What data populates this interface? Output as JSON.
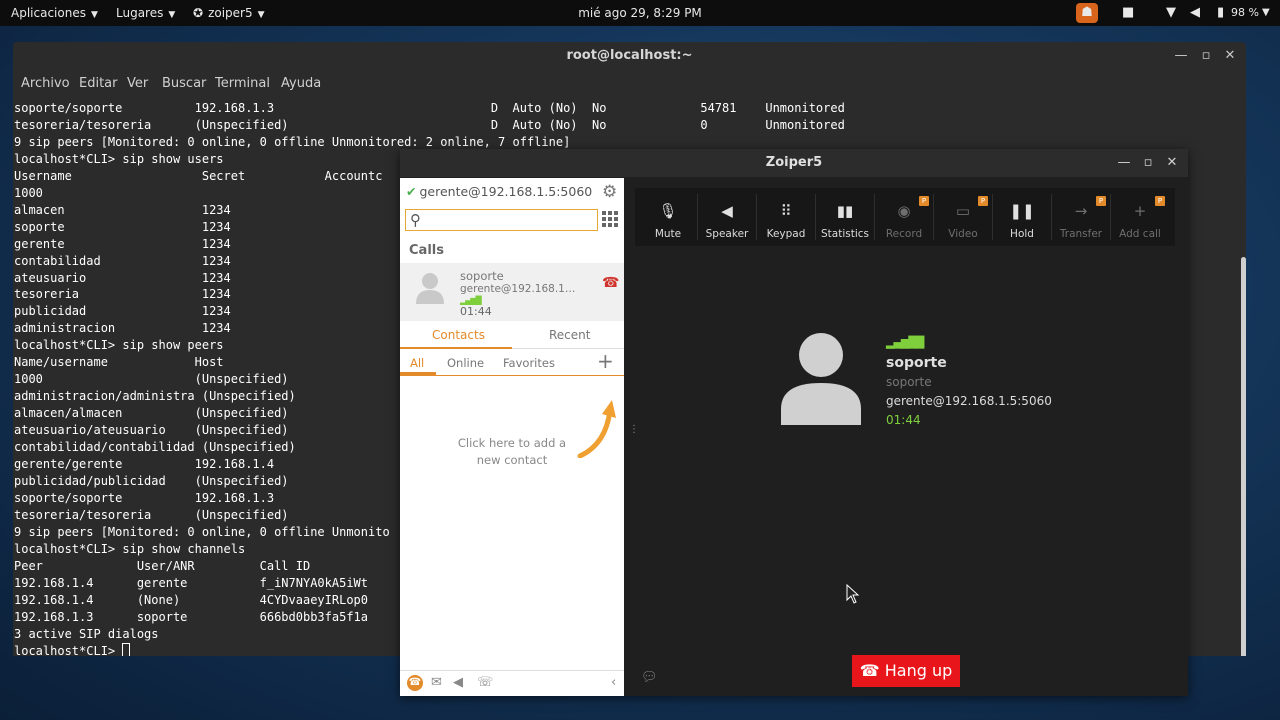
{
  "topbar": {
    "apps": "Aplicaciones",
    "places": "Lugares",
    "current_app": "zoiper5",
    "clock": "mié ago 29,  8:29 PM",
    "battery": "98 %"
  },
  "terminal": {
    "title": "root@localhost:~",
    "menu": [
      "Archivo",
      "Editar",
      "Ver",
      "Buscar",
      "Terminal",
      "Ayuda"
    ],
    "lines": [
      "soporte/soporte          192.168.1.3                              D  Auto (No)  No             54781    Unmonitored",
      "tesoreria/tesoreria      (Unspecified)                            D  Auto (No)  No             0        Unmonitored",
      "9 sip peers [Monitored: 0 online, 0 offline Unmonitored: 2 online, 7 offline]",
      "localhost*CLI> sip show users",
      "Username                  Secret           Accountc",
      "1000",
      "almacen                   1234",
      "soporte                   1234",
      "gerente                   1234",
      "contabilidad              1234",
      "ateusuario                1234",
      "tesoreria                 1234",
      "publicidad                1234",
      "administracion            1234",
      "localhost*CLI> sip show peers",
      "Name/username            Host",
      "1000                     (Unspecified)",
      "administracion/administra (Unspecified)",
      "almacen/almacen          (Unspecified)",
      "ateusuario/ateusuario    (Unspecified)",
      "contabilidad/contabilidad (Unspecified)",
      "gerente/gerente          192.168.1.4",
      "publicidad/publicidad    (Unspecified)",
      "soporte/soporte          192.168.1.3",
      "tesoreria/tesoreria      (Unspecified)",
      "9 sip peers [Monitored: 0 online, 0 offline Unmonito",
      "localhost*CLI> sip show channels",
      "Peer             User/ANR         Call ID",
      "192.168.1.4      gerente          f_iN7NYA0kA5iWt",
      "192.168.1.4      (None)           4CYDvaaeyIRLop0",
      "192.168.1.3      soporte          666bd0bb3fa5f1a",
      "3 active SIP dialogs"
    ],
    "prompt": "localhost*CLI> "
  },
  "zoiper": {
    "title": "Zoiper5",
    "account": "gerente@192.168.1.5:5060",
    "search_placeholder": "",
    "calls_label": "Calls",
    "call_item": {
      "name": "soporte",
      "account": "gerente@192.168.1.5:5060",
      "time": "01:44"
    },
    "tabs": [
      "Contacts",
      "Recent"
    ],
    "subtabs": [
      "All",
      "Online",
      "Favorites"
    ],
    "add_contact_hint_1": "Click here to add a",
    "add_contact_hint_2": "new contact",
    "toolbar": [
      {
        "label": "Mute",
        "icon": "mic-off-icon",
        "disabled": false,
        "badge": ""
      },
      {
        "label": "Speaker",
        "icon": "speaker-icon",
        "disabled": false,
        "badge": ""
      },
      {
        "label": "Keypad",
        "icon": "keypad-icon",
        "disabled": false,
        "badge": ""
      },
      {
        "label": "Statistics",
        "icon": "statistics-icon",
        "disabled": false,
        "badge": ""
      },
      {
        "label": "Record",
        "icon": "record-icon",
        "disabled": true,
        "badge": "P"
      },
      {
        "label": "Video",
        "icon": "video-icon",
        "disabled": true,
        "badge": "P"
      },
      {
        "label": "Hold",
        "icon": "pause-icon",
        "disabled": false,
        "badge": ""
      },
      {
        "label": "Transfer",
        "icon": "transfer-icon",
        "disabled": true,
        "badge": "P"
      },
      {
        "label": "Add call",
        "icon": "add-call-icon",
        "disabled": true,
        "badge": "P"
      }
    ],
    "callee": {
      "name": "soporte",
      "sub": "soporte",
      "account": "gerente@192.168.1.5:5060",
      "time": "01:44"
    },
    "hangup_label": "Hang up",
    "colors": {
      "accent": "#e38a2b",
      "hangup": "#e8161a",
      "signal": "#7fcf3c"
    }
  }
}
